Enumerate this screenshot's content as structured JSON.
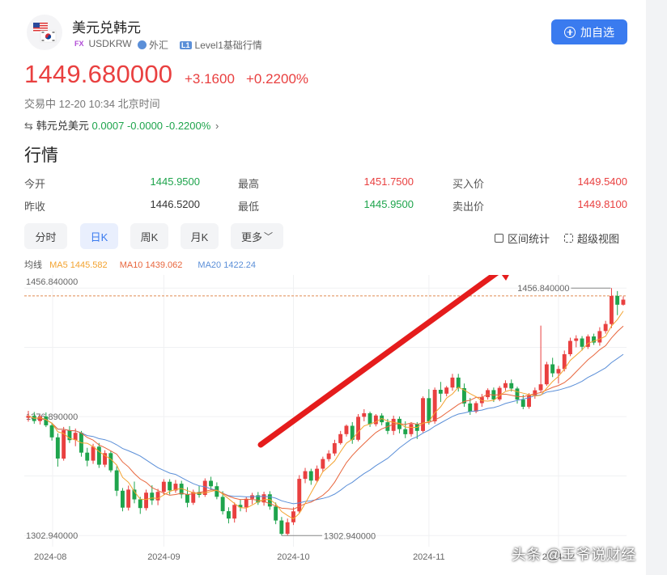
{
  "header": {
    "title": "美元兑韩元",
    "fx_tag": "FX",
    "symbol": "USDKRW",
    "market": "外汇",
    "level_tag": "L1",
    "level": "Level1基础行情",
    "add_button": "加自选"
  },
  "quote": {
    "last": "1449.680000",
    "change": "+3.1600",
    "change_pct": "+0.2200%",
    "status": "交易中 12-20 10:34 北京时间"
  },
  "inverse": {
    "label": "韩元兑美元",
    "last": "0.0007",
    "change": "-0.0000",
    "change_pct": "-0.2200%"
  },
  "section_title": "行情",
  "stats": {
    "open_label": "今开",
    "open": "1445.9500",
    "high_label": "最高",
    "high": "1451.7500",
    "bid_label": "买入价",
    "bid": "1449.5400",
    "prev_label": "昨收",
    "prev": "1446.5200",
    "low_label": "最低",
    "low": "1445.9500",
    "ask_label": "卖出价",
    "ask": "1449.8100"
  },
  "tabs": {
    "minute": "分时",
    "day": "日K",
    "week": "周K",
    "month": "月K",
    "more": "更多"
  },
  "tools": {
    "range_stats": "区间统计",
    "super_view": "超级视图"
  },
  "ma": {
    "label": "均线",
    "ma5": "MA5 1445.582",
    "ma10": "MA10 1439.062",
    "ma20": "MA20 1422.24",
    "ma5_color": "#f3a330",
    "ma10_color": "#e8663d",
    "ma20_color": "#5b8fd8"
  },
  "colors": {
    "up": "#e94040",
    "down": "#1ea44c",
    "accent": "#3a7bef"
  },
  "watermark": "头条 @王爷说财经",
  "chart_data": {
    "type": "candlestick",
    "x_labels": [
      "2024-08",
      "2024-09",
      "2024-10",
      "2024-11",
      "2024-12"
    ],
    "y_labels": [
      "1456.840000",
      "1376.890000",
      "1302.940000"
    ],
    "max_label": "1456.840000",
    "min_label": "1302.940000",
    "ylim": [
      1296,
      1464
    ],
    "month_start_index": [
      0,
      23,
      45,
      68,
      90
    ],
    "current_price": 1449.68,
    "annotation": "red arrow pointing up-right",
    "ohlc": [
      [
        1376.2,
        1380.5,
        1373.8,
        1377.4
      ],
      [
        1377.4,
        1379.8,
        1372.5,
        1374.2
      ],
      [
        1374.2,
        1378.0,
        1372.0,
        1377.0
      ],
      [
        1377.0,
        1379.5,
        1370.4,
        1371.5
      ],
      [
        1371.5,
        1373.0,
        1362.0,
        1364.0
      ],
      [
        1364.0,
        1366.5,
        1345.8,
        1350.8
      ],
      [
        1350.8,
        1370.5,
        1349.5,
        1368.5
      ],
      [
        1368.5,
        1371.0,
        1360.5,
        1362.3
      ],
      [
        1362.3,
        1369.5,
        1358.5,
        1366.8
      ],
      [
        1366.8,
        1368.0,
        1352.0,
        1354.5
      ],
      [
        1354.5,
        1357.5,
        1346.0,
        1349.5
      ],
      [
        1349.5,
        1360.0,
        1347.5,
        1358.2
      ],
      [
        1358.2,
        1360.5,
        1345.0,
        1347.0
      ],
      [
        1347.0,
        1356.0,
        1345.5,
        1354.2
      ],
      [
        1354.2,
        1355.5,
        1342.2,
        1343.5
      ],
      [
        1343.5,
        1346.0,
        1327.5,
        1330.8
      ],
      [
        1330.8,
        1332.5,
        1318.0,
        1320.3
      ],
      [
        1320.3,
        1334.0,
        1318.5,
        1331.5
      ],
      [
        1331.5,
        1336.5,
        1323.0,
        1325.4
      ],
      [
        1325.4,
        1327.0,
        1316.4,
        1320.0
      ],
      [
        1320.0,
        1331.5,
        1318.5,
        1329.6
      ],
      [
        1329.6,
        1334.2,
        1322.0,
        1324.8
      ],
      [
        1324.8,
        1332.0,
        1321.8,
        1330.1
      ],
      [
        1330.1,
        1338.0,
        1328.0,
        1336.4
      ],
      [
        1336.4,
        1338.0,
        1328.5,
        1331.0
      ],
      [
        1331.0,
        1337.5,
        1329.5,
        1335.2
      ],
      [
        1335.2,
        1337.0,
        1326.0,
        1328.5
      ],
      [
        1328.5,
        1333.0,
        1320.5,
        1323.3
      ],
      [
        1323.3,
        1331.5,
        1322.0,
        1330.0
      ],
      [
        1330.0,
        1334.0,
        1326.5,
        1328.2
      ],
      [
        1328.2,
        1338.5,
        1327.0,
        1337.0
      ],
      [
        1337.0,
        1339.5,
        1331.0,
        1333.6
      ],
      [
        1333.6,
        1336.0,
        1325.5,
        1327.0
      ],
      [
        1327.0,
        1330.5,
        1316.0,
        1318.1
      ],
      [
        1318.1,
        1320.5,
        1310.5,
        1313.5
      ],
      [
        1313.5,
        1323.5,
        1311.0,
        1322.0
      ],
      [
        1322.0,
        1325.5,
        1318.0,
        1320.5
      ],
      [
        1320.5,
        1327.0,
        1317.5,
        1325.8
      ],
      [
        1325.8,
        1329.5,
        1322.5,
        1328.0
      ],
      [
        1328.0,
        1330.0,
        1322.0,
        1323.5
      ],
      [
        1323.5,
        1330.2,
        1321.5,
        1328.6
      ],
      [
        1328.6,
        1330.5,
        1319.0,
        1321.0
      ],
      [
        1321.0,
        1323.5,
        1310.0,
        1312.3
      ],
      [
        1312.3,
        1314.5,
        1302.9,
        1304.0
      ],
      [
        1304.0,
        1313.5,
        1302.9,
        1311.2
      ],
      [
        1311.2,
        1320.5,
        1309.5,
        1318.0
      ],
      [
        1318.0,
        1340.5,
        1317.0,
        1338.2
      ],
      [
        1338.2,
        1345.0,
        1335.5,
        1343.0
      ],
      [
        1343.0,
        1344.5,
        1334.5,
        1337.1
      ],
      [
        1337.1,
        1346.5,
        1336.0,
        1344.5
      ],
      [
        1344.5,
        1352.0,
        1342.5,
        1350.5
      ],
      [
        1350.5,
        1356.0,
        1349.0,
        1354.0
      ],
      [
        1354.0,
        1362.5,
        1352.5,
        1360.4
      ],
      [
        1360.4,
        1368.0,
        1359.5,
        1366.0
      ],
      [
        1366.0,
        1372.0,
        1364.5,
        1371.2
      ],
      [
        1371.2,
        1373.5,
        1360.0,
        1362.5
      ],
      [
        1362.5,
        1378.5,
        1361.5,
        1376.8
      ],
      [
        1376.8,
        1381.5,
        1374.0,
        1379.0
      ],
      [
        1379.0,
        1380.0,
        1370.5,
        1372.2
      ],
      [
        1372.2,
        1378.5,
        1370.8,
        1377.6
      ],
      [
        1377.6,
        1379.0,
        1371.5,
        1373.4
      ],
      [
        1373.4,
        1375.5,
        1366.0,
        1368.0
      ],
      [
        1368.0,
        1377.5,
        1365.5,
        1375.5
      ],
      [
        1375.5,
        1377.0,
        1366.5,
        1369.1
      ],
      [
        1369.1,
        1374.0,
        1363.5,
        1366.0
      ],
      [
        1366.0,
        1373.5,
        1364.5,
        1372.3
      ],
      [
        1372.3,
        1373.5,
        1363.0,
        1368.0
      ],
      [
        1368.0,
        1389.5,
        1367.0,
        1388.4
      ],
      [
        1388.4,
        1394.0,
        1372.0,
        1374.0
      ],
      [
        1374.0,
        1395.0,
        1372.5,
        1393.6
      ],
      [
        1393.6,
        1398.5,
        1386.0,
        1391.2
      ],
      [
        1391.2,
        1396.0,
        1389.5,
        1395.0
      ],
      [
        1395.0,
        1403.5,
        1393.0,
        1401.2
      ],
      [
        1401.2,
        1403.5,
        1392.5,
        1394.6
      ],
      [
        1394.6,
        1397.5,
        1383.0,
        1385.1
      ],
      [
        1385.1,
        1388.5,
        1378.0,
        1380.0
      ],
      [
        1380.0,
        1386.5,
        1379.0,
        1385.3
      ],
      [
        1385.3,
        1391.0,
        1383.0,
        1389.0
      ],
      [
        1389.0,
        1394.5,
        1387.5,
        1393.4
      ],
      [
        1393.4,
        1395.0,
        1386.0,
        1387.6
      ],
      [
        1387.6,
        1396.0,
        1386.5,
        1394.8
      ],
      [
        1394.8,
        1399.5,
        1393.0,
        1397.7
      ],
      [
        1397.7,
        1400.0,
        1392.5,
        1394.4
      ],
      [
        1394.4,
        1395.5,
        1385.0,
        1387.5
      ],
      [
        1387.5,
        1390.5,
        1381.5,
        1383.0
      ],
      [
        1383.0,
        1391.5,
        1381.8,
        1390.2
      ],
      [
        1390.2,
        1395.0,
        1388.0,
        1393.3
      ],
      [
        1393.3,
        1433.5,
        1392.0,
        1397.0
      ],
      [
        1397.0,
        1411.0,
        1396.0,
        1409.4
      ],
      [
        1409.4,
        1413.5,
        1401.5,
        1403.8
      ],
      [
        1403.8,
        1408.5,
        1397.5,
        1406.5
      ],
      [
        1406.5,
        1418.0,
        1405.0,
        1415.7
      ],
      [
        1415.7,
        1426.0,
        1414.5,
        1424.0
      ],
      [
        1424.0,
        1427.5,
        1420.0,
        1425.5
      ],
      [
        1425.5,
        1427.0,
        1418.0,
        1420.3
      ],
      [
        1420.3,
        1428.0,
        1419.0,
        1426.8
      ],
      [
        1426.8,
        1428.5,
        1421.5,
        1423.0
      ],
      [
        1423.0,
        1432.5,
        1421.0,
        1430.1
      ],
      [
        1430.1,
        1436.5,
        1428.5,
        1434.5
      ],
      [
        1434.5,
        1456.84,
        1432.0,
        1452.0
      ],
      [
        1452.0,
        1455.0,
        1440.0,
        1446.5
      ],
      [
        1446.5,
        1451.75,
        1445.95,
        1449.68
      ]
    ]
  }
}
